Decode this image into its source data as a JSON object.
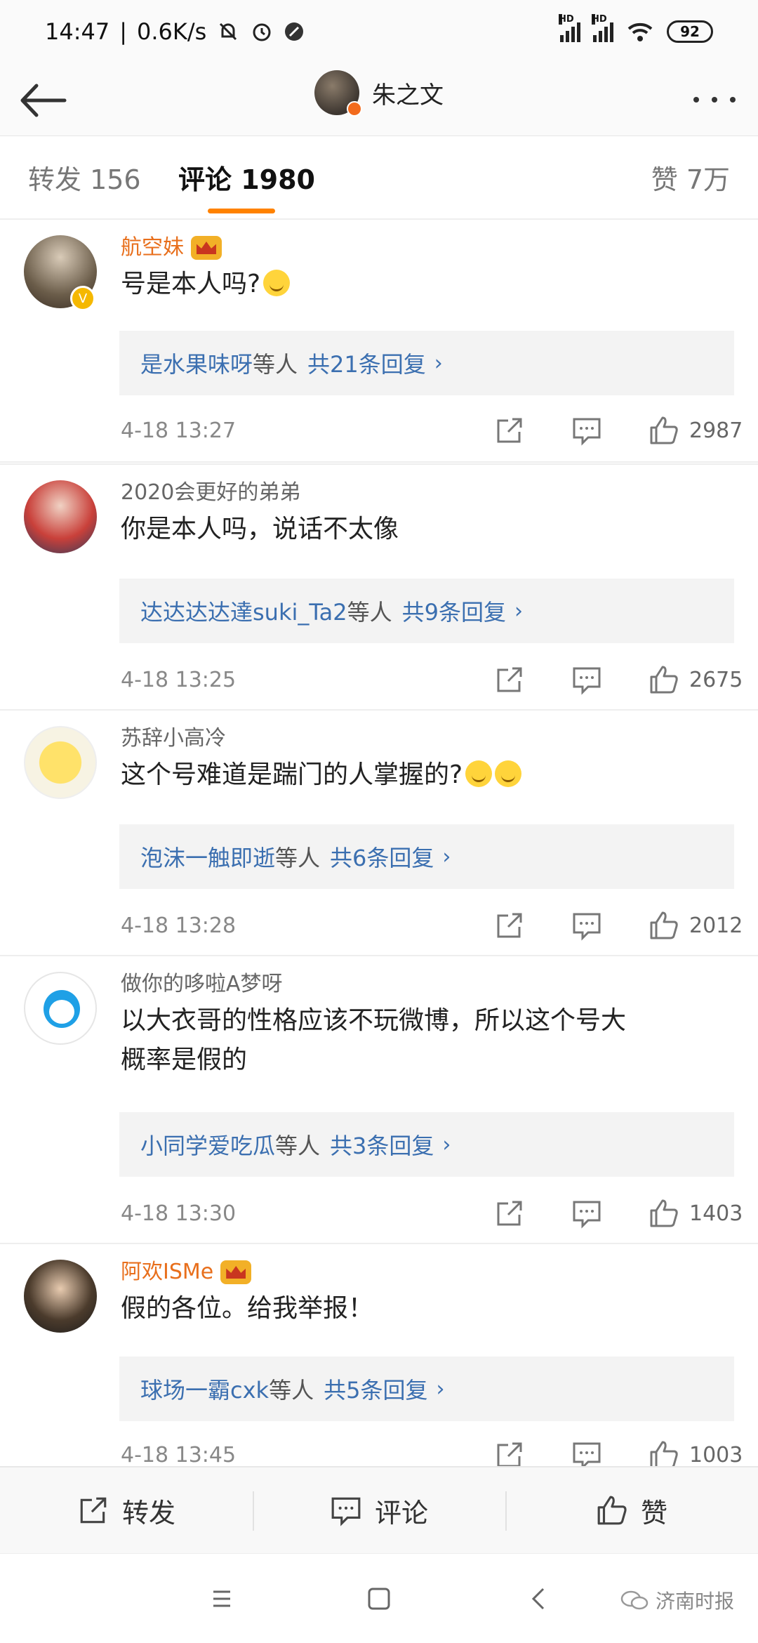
{
  "status_bar": {
    "time": "14:47",
    "speed": "0.6K/s",
    "hd_label": "HD",
    "battery": "92"
  },
  "header": {
    "title": "朱之文"
  },
  "tabs": {
    "repost": "转发 156",
    "comments": "评论 1980",
    "likes": "赞 7万"
  },
  "comments": [
    {
      "username": "航空妹",
      "text": "号是本人吗?",
      "reply_names": "是水果味呀",
      "reply_sep": "等人",
      "reply_count": "共21条回复",
      "time": "4-18 13:27",
      "likes": "2987"
    },
    {
      "username": "2020会更好的弟弟",
      "text": "你是本人吗，说话不太像",
      "reply_names": "达达达达達suki_Ta2",
      "reply_sep": "等人",
      "reply_count": "共9条回复",
      "time": "4-18 13:25",
      "likes": "2675"
    },
    {
      "username": "苏辞小高冷",
      "text": "这个号难道是踹门的人掌握的?",
      "reply_names": "泡沫一触即逝",
      "reply_sep": "等人",
      "reply_count": "共6条回复",
      "time": "4-18 13:28",
      "likes": "2012"
    },
    {
      "username": "做你的哆啦A梦呀",
      "text_line1": "以大衣哥的性格应该不玩微博，所以这个号大",
      "text_line2": "概率是假的",
      "reply_names": "小同学爱吃瓜",
      "reply_sep": "等人",
      "reply_count": "共3条回复",
      "time": "4-18 13:30",
      "likes": "1403"
    },
    {
      "username": "阿欢ISMe",
      "text": "假的各位。给我举报！",
      "reply_names": "球场一霸cxk",
      "reply_sep": "等人",
      "reply_count": "共5条回复",
      "time": "4-18 13:45",
      "likes": "1003"
    }
  ],
  "reply_chevron": "›",
  "bottom_bar": {
    "repost": "转发",
    "comment": "评论",
    "like": "赞"
  },
  "watermark": "济南时报",
  "colors": {
    "accent": "#ff8200",
    "link": "#3b6fb0",
    "vip_name": "#e86f1c"
  }
}
